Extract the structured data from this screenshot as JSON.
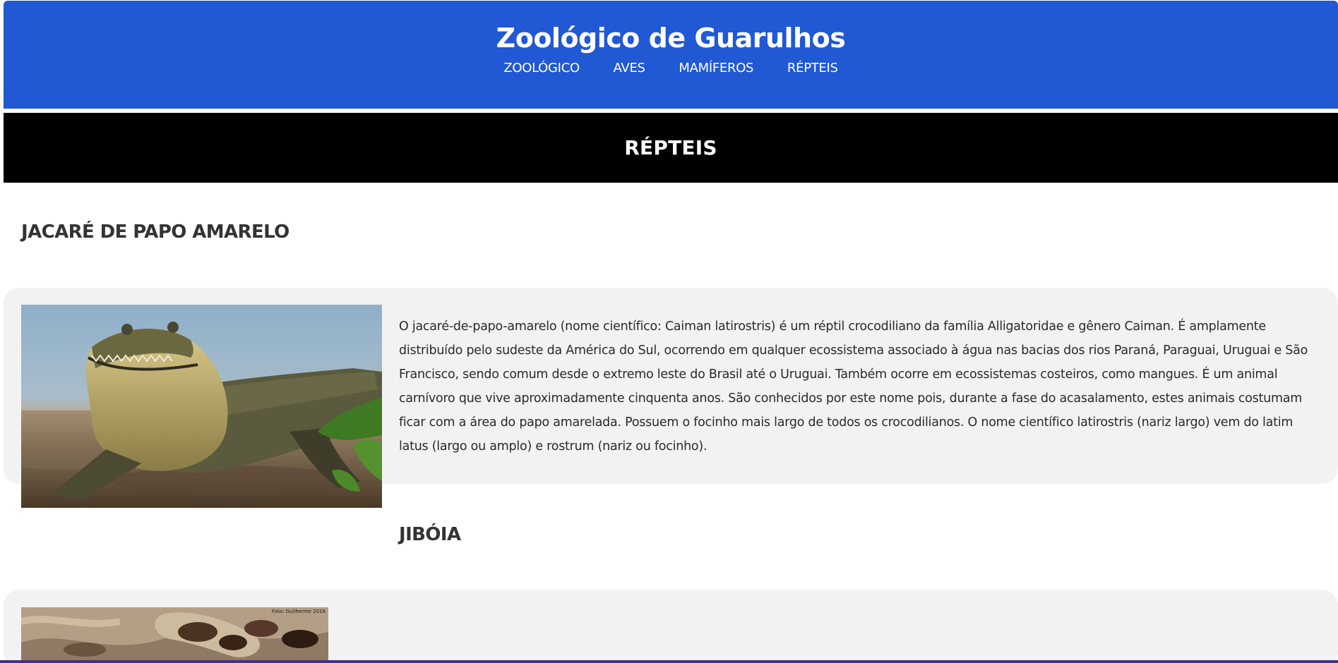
{
  "site": {
    "title": "Zoológico de Guarulhos",
    "nav": [
      {
        "label": "ZOOLÓGICO"
      },
      {
        "label": "AVES"
      },
      {
        "label": "MAMÍFEROS"
      },
      {
        "label": "RÉPTEIS"
      }
    ]
  },
  "section": {
    "title": "RÉPTEIS"
  },
  "animals": [
    {
      "name": "JACARÉ DE PAPO AMARELO",
      "description": "O jacaré-de-papo-amarelo (nome científico: Caiman latirostris) é um réptil crocodiliano da família Alligatoridae e gênero Caiman. É amplamente distribuído pelo sudeste da América do Sul, ocorrendo em qualquer ecossistema associado à água nas bacias dos rios Paraná, Paraguai, Uruguai e São Francisco, sendo comum desde o extremo leste do Brasil até o Uruguai. Também ocorre em ecossistemas costeiros, como mangues. É um animal carnívoro que vive aproximadamente cinquenta anos. São conhecidos por este nome pois, durante a fase do acasalamento, estes animais costumam ficar com a área do papo amarelada. Possuem o focinho mais largo de todos os crocodilianos. O nome científico latirostris (nariz largo) vem do latim latus (largo ou amplo) e rostrum (nariz ou focinho)."
    },
    {
      "name": "JIBÓIA",
      "photo_credit": "Foto: Guilherme 2018"
    }
  ],
  "colors": {
    "header": "#2158d3",
    "banner": "#000000",
    "card": "#f2f2f2",
    "heading_text": "#333333"
  }
}
